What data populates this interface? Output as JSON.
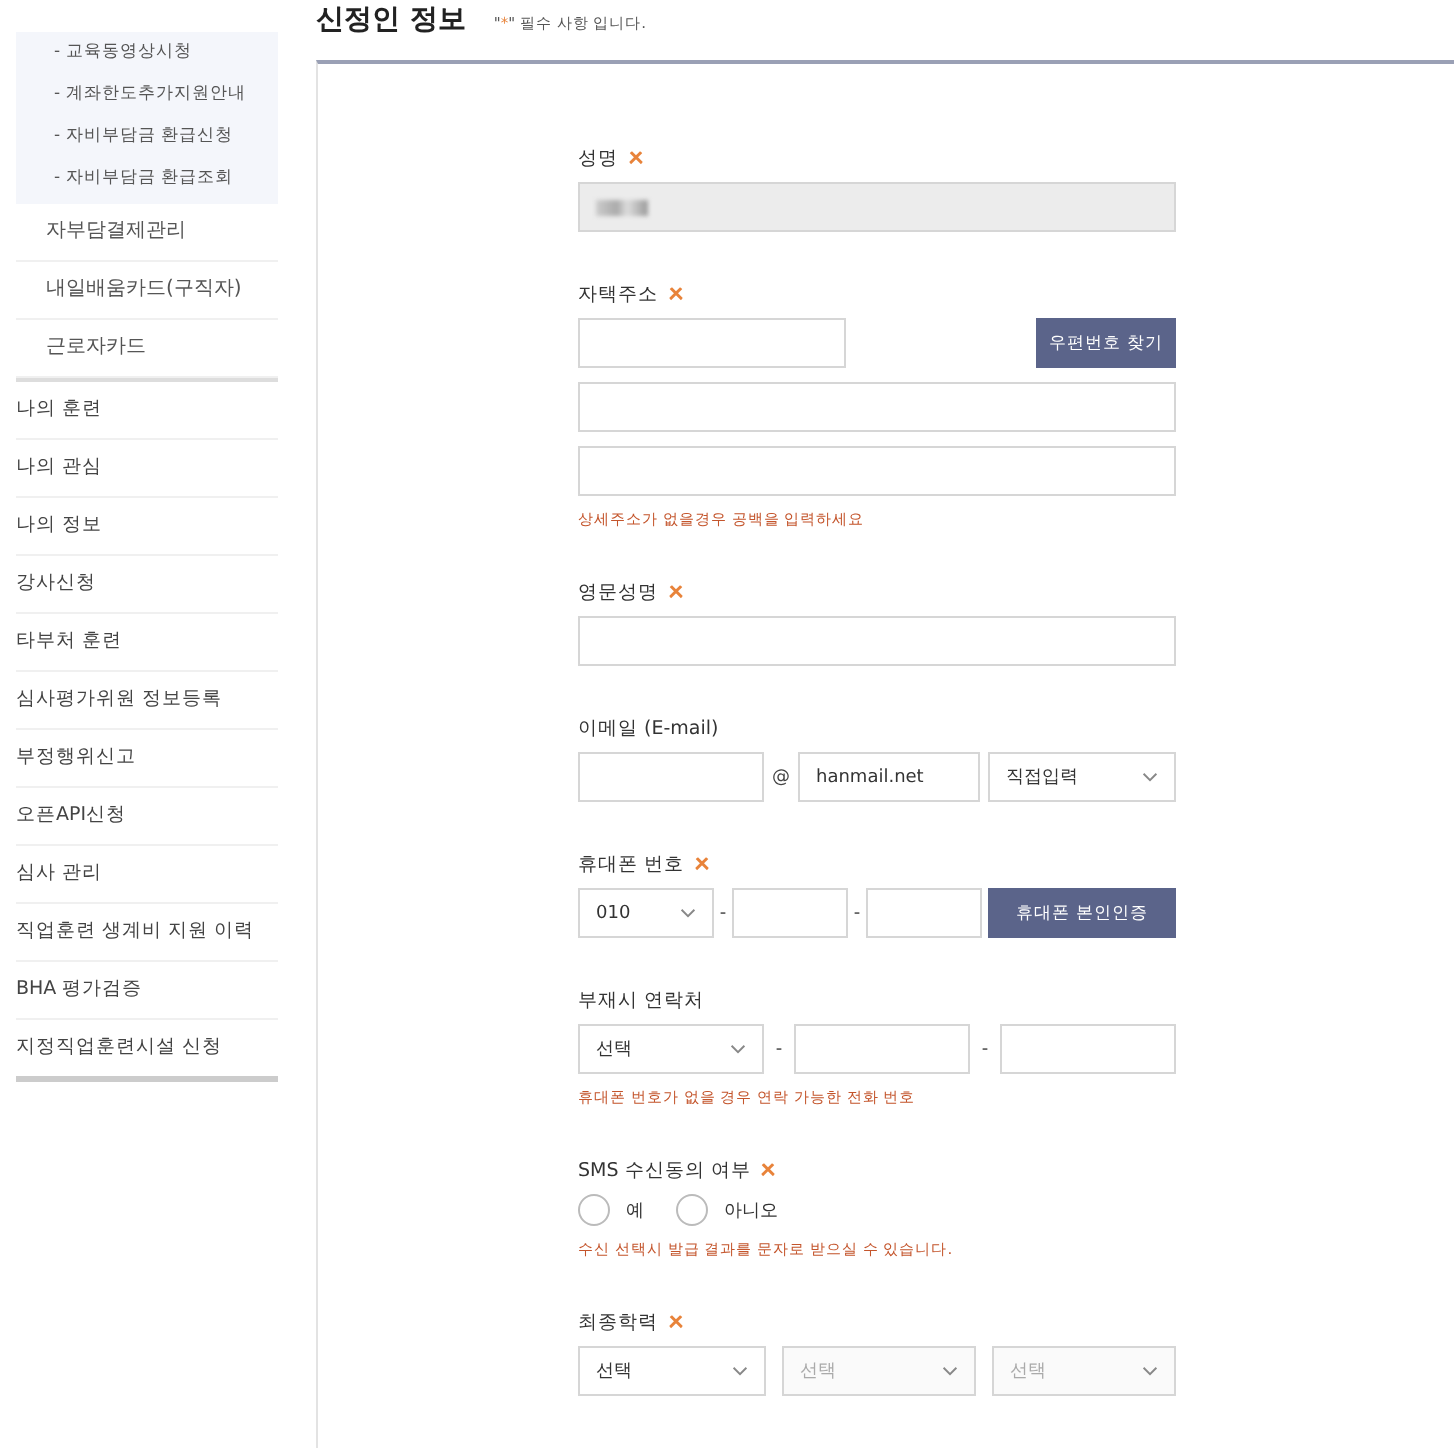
{
  "sidebar": {
    "submenu": [
      {
        "label": "- 교육동영상시청"
      },
      {
        "label": "- 계좌한도추가지원안내"
      },
      {
        "label": "- 자비부담금 환급신청"
      },
      {
        "label": "- 자비부담금 환급조회"
      }
    ],
    "subitems": [
      {
        "label": "자부담결제관리"
      },
      {
        "label": "내일배움카드(구직자)"
      },
      {
        "label": "근로자카드"
      }
    ],
    "items": [
      {
        "label": "나의 훈련"
      },
      {
        "label": "나의 관심"
      },
      {
        "label": "나의 정보"
      },
      {
        "label": "강사신청"
      },
      {
        "label": "타부처 훈련"
      },
      {
        "label": "심사평가위원 정보등록"
      },
      {
        "label": "부정행위신고"
      },
      {
        "label": "오픈API신청"
      },
      {
        "label": "심사 관리"
      },
      {
        "label": "직업훈련 생계비 지원 이력"
      },
      {
        "label": "BHA 평가검증"
      },
      {
        "label": "지정직업훈련시설 신청"
      }
    ]
  },
  "page": {
    "title": "신정인 정보",
    "required_note": {
      "before": "\"",
      "mark": "*",
      "after": "\" 필수 사항 입니다."
    }
  },
  "form": [
    {
      "label": "성명",
      "required": true,
      "rows": [
        {
          "kind": "full",
          "controls": [
            {
              "kind": "input",
              "disabled": true,
              "masked": true
            }
          ]
        }
      ]
    },
    {
      "label": "자택주소",
      "required": true,
      "rows": [
        {
          "kind": "zip",
          "controls": [
            {
              "kind": "input",
              "disabled": false
            },
            {
              "kind": "button",
              "label": "우편번호 찾기"
            }
          ]
        },
        {
          "kind": "full",
          "controls": [
            {
              "kind": "input",
              "disabled": false
            }
          ]
        },
        {
          "kind": "full",
          "controls": [
            {
              "kind": "input",
              "disabled": false
            }
          ]
        }
      ],
      "help": "상세주소가 없을경우 공백을 입력하세요"
    },
    {
      "label": "영문성명",
      "required": true,
      "rows": [
        {
          "kind": "full",
          "controls": [
            {
              "kind": "input",
              "disabled": false
            }
          ]
        }
      ]
    },
    {
      "label": "이메일 (E-mail)",
      "required": false,
      "rows": [
        {
          "kind": "email",
          "controls": [
            {
              "kind": "input",
              "disabled": false
            },
            {
              "kind": "text",
              "text": "@"
            },
            {
              "kind": "input",
              "disabled": false,
              "value": "hanmail.net"
            },
            {
              "kind": "select",
              "disabled": false,
              "value": "직접입력"
            }
          ]
        }
      ]
    },
    {
      "label": "휴대폰 번호",
      "required": true,
      "rows": [
        {
          "kind": "phone",
          "controls": [
            {
              "kind": "select",
              "disabled": false,
              "value": "010"
            },
            {
              "kind": "text",
              "text": "-"
            },
            {
              "kind": "input",
              "disabled": false
            },
            {
              "kind": "text",
              "text": "-"
            },
            {
              "kind": "input",
              "disabled": false
            },
            {
              "kind": "button",
              "label": "휴대폰 본인인증"
            }
          ]
        }
      ]
    },
    {
      "label": "부재시 연락처",
      "required": false,
      "rows": [
        {
          "kind": "tel",
          "controls": [
            {
              "kind": "select",
              "disabled": false,
              "value": "선택"
            },
            {
              "kind": "text",
              "text": "-"
            },
            {
              "kind": "input",
              "disabled": false
            },
            {
              "kind": "text",
              "text": "-"
            },
            {
              "kind": "input",
              "disabled": false
            }
          ]
        }
      ],
      "help": "휴대폰 번호가 없을 경우 연락 가능한 전화 번호"
    },
    {
      "label": "SMS 수신동의 여부",
      "required": true,
      "rows": [
        {
          "kind": "choice",
          "controls": [
            {
              "kind": "radio",
              "label": "예",
              "selected": false
            },
            {
              "kind": "radio",
              "label": "아니오",
              "selected": false
            }
          ]
        }
      ],
      "help": "수신 선택시 발급 결과를 문자로 받으실 수 있습니다."
    },
    {
      "label": "최종학력",
      "required": true,
      "rows": [
        {
          "kind": "triple",
          "controls": [
            {
              "kind": "select",
              "disabled": false,
              "value": "선택"
            },
            {
              "kind": "select",
              "disabled": true,
              "value": "선택"
            },
            {
              "kind": "select",
              "disabled": true,
              "value": "선택"
            }
          ]
        }
      ]
    }
  ]
}
